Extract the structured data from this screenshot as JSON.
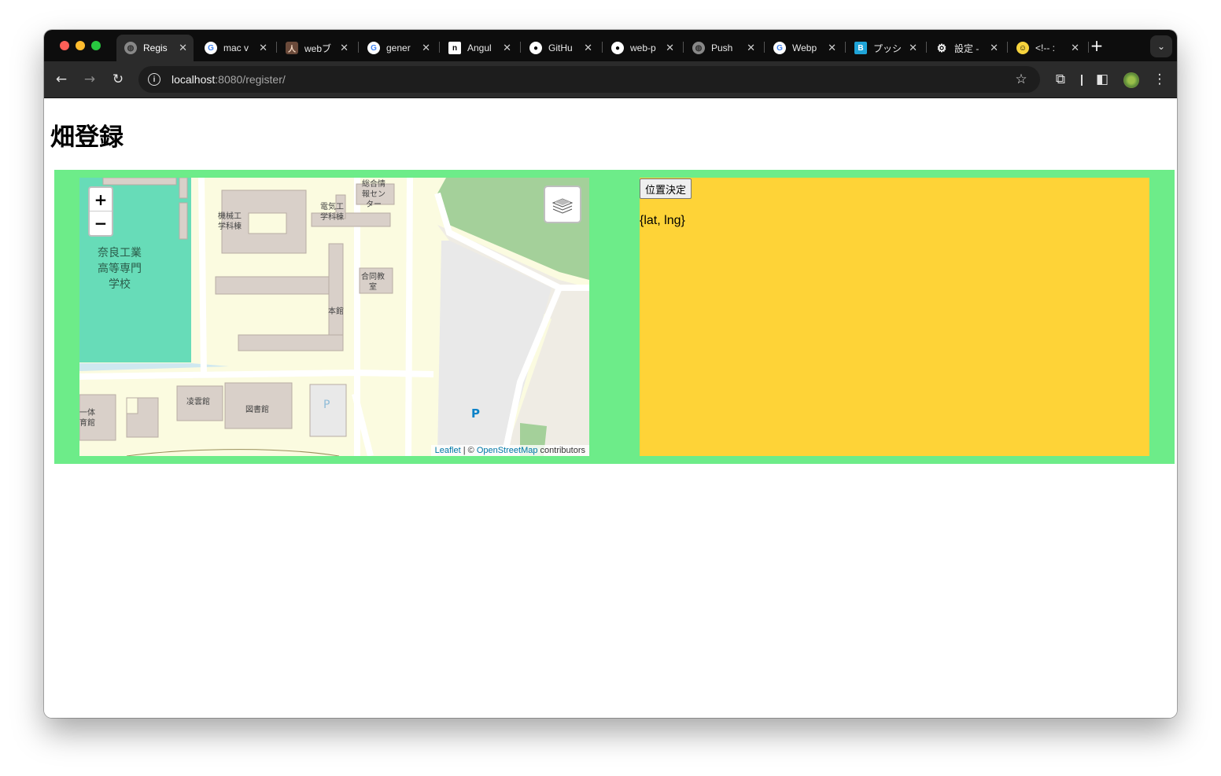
{
  "browser": {
    "tabs": [
      {
        "title": "Regis",
        "favicon": "globe-icon",
        "active": true
      },
      {
        "title": "mac v",
        "favicon": "google-icon"
      },
      {
        "title": "webブ",
        "favicon": "avatar-icon"
      },
      {
        "title": "gener",
        "favicon": "google-icon"
      },
      {
        "title": "Angul",
        "favicon": "notion-icon"
      },
      {
        "title": "GitHu",
        "favicon": "github-icon"
      },
      {
        "title": "web-p",
        "favicon": "github-icon"
      },
      {
        "title": "Push",
        "favicon": "globe-icon"
      },
      {
        "title": "Webp",
        "favicon": "google-icon"
      },
      {
        "title": "プッシ",
        "favicon": "blog-icon"
      },
      {
        "title": "設定 -",
        "favicon": "gear-icon"
      },
      {
        "title": "<!-- :",
        "favicon": "emoji-icon"
      }
    ],
    "url_host": "localhost",
    "url_rest": ":8080/register/"
  },
  "page": {
    "title": "畑登録",
    "decide_button": "位置決定",
    "coords_text": "{lat, lng}"
  },
  "map": {
    "labels": {
      "school": [
        "奈良工業",
        "高等専門",
        "学校"
      ],
      "mech": [
        "機械工",
        "学科棟"
      ],
      "elec": [
        "電気工",
        "学科棟"
      ],
      "info": [
        "総合情",
        "報セン",
        "ター"
      ],
      "lecture": [
        "合同教",
        "室"
      ],
      "honkan": "本館",
      "ryoun": "凌雲館",
      "library": "図書館",
      "ittai": [
        "一体",
        "育館"
      ],
      "parking1": "P",
      "parking2": "P"
    },
    "zoom_in": "+",
    "zoom_out": "−",
    "attribution": {
      "leaflet": "Leaflet",
      "sep": " | © ",
      "osm": "OpenStreetMap",
      "contrib": " contributors"
    }
  },
  "colors": {
    "container_bg": "#6dec89",
    "panel_bg": "#fed337",
    "water": "#67dcb8",
    "building": "#d9d0c9",
    "park": "#a4d09a"
  }
}
